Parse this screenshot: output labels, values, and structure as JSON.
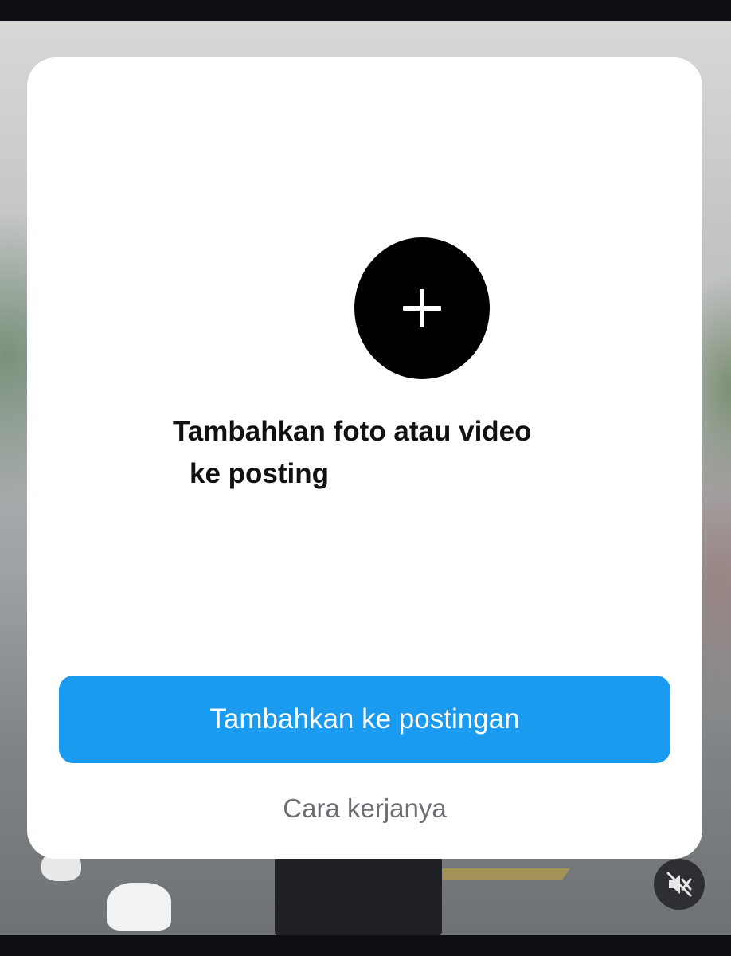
{
  "dialog": {
    "prompt_line_1": "Tambahkan foto atau video",
    "prompt_line_2": "ke posting",
    "primary_button_label": "Tambahkan ke postingan",
    "secondary_link_label": "Cara kerjanya"
  },
  "icons": {
    "add_media": "plus-icon",
    "mute": "speaker-muted-icon"
  },
  "colors": {
    "primary_button": "#1a9bf0",
    "secondary_text": "#6b6e73",
    "modal_background": "#ffffff"
  }
}
